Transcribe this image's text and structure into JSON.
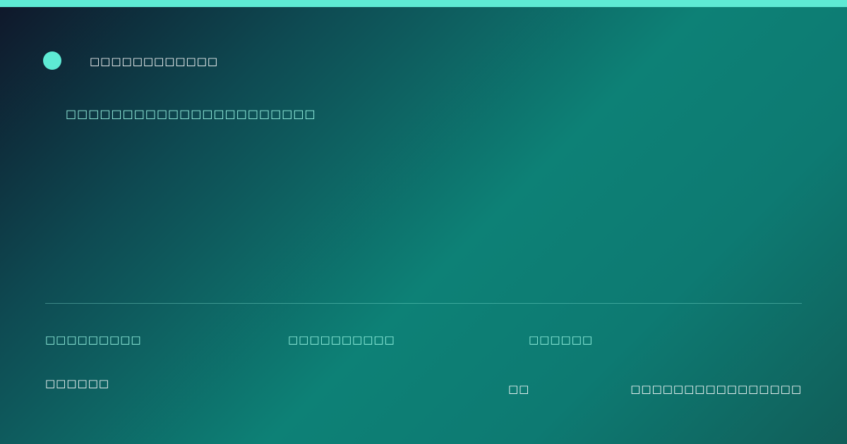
{
  "brand": {
    "name": "□□□□□□□□□□□□"
  },
  "headline": {
    "subtitle": "□□□□□□□□□□□□□□□□□□□□□□"
  },
  "meta": {
    "item1": "□□□□□□□□□",
    "item2": "□□□□□□□□□□",
    "item3": "□□□□□□"
  },
  "footer": {
    "left": "□□□□□□",
    "middle": "□□",
    "right": "□□□□□□□□□□□□□□□□"
  },
  "colors": {
    "accent": "#5eead4",
    "accent_text": "#99f6e4",
    "background_start": "#0f172a",
    "background_mid": "#0d8176",
    "background_end": "#115e59"
  }
}
